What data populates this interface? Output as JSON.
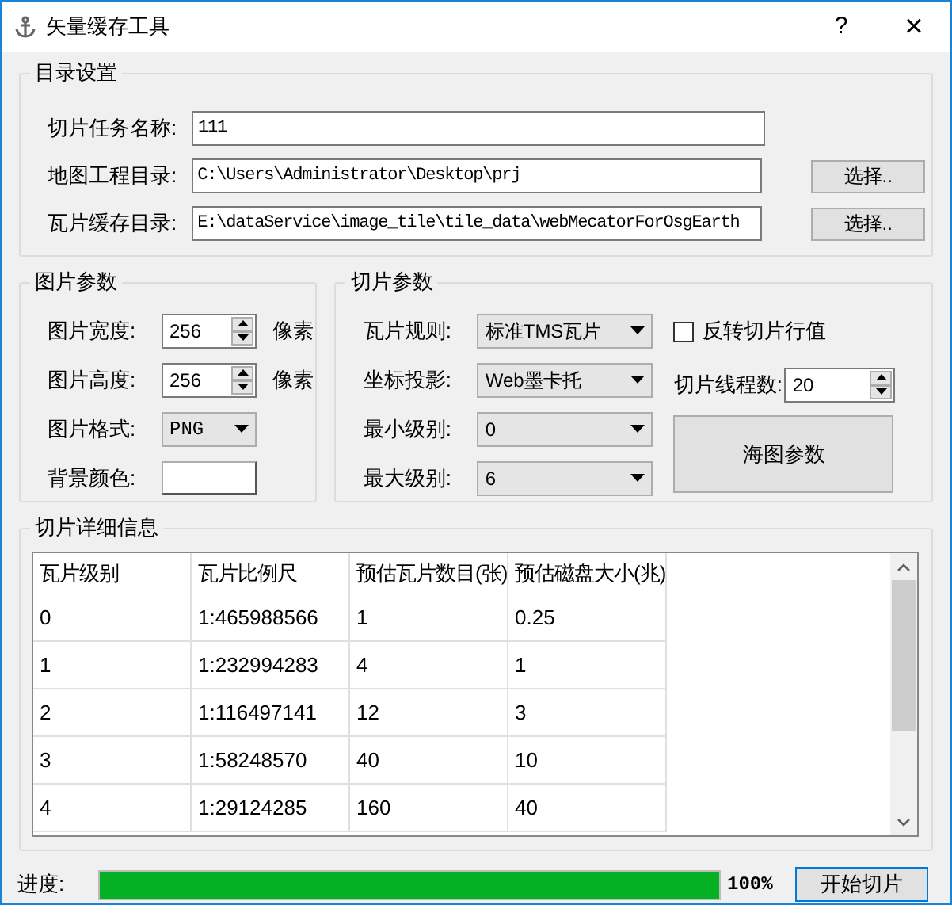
{
  "window": {
    "title": "矢量缓存工具",
    "help": "?",
    "close": "×"
  },
  "directory_settings": {
    "title": "目录设置",
    "fields": [
      {
        "label": "切片任务名称:",
        "value": "111"
      },
      {
        "label": "地图工程目录:",
        "value": "C:\\Users\\Administrator\\Desktop\\prj",
        "button": "选择.."
      },
      {
        "label": "瓦片缓存目录:",
        "value": "E:\\dataService\\image_tile\\tile_data\\webMecatorForOsgEarth",
        "button": "选择.."
      }
    ]
  },
  "image_params": {
    "title": "图片参数",
    "rows": [
      {
        "kind": "spin",
        "label": "图片宽度:",
        "value": "256",
        "unit": "像素"
      },
      {
        "kind": "spin",
        "label": "图片高度:",
        "value": "256",
        "unit": "像素"
      },
      {
        "kind": "combo",
        "label": "图片格式:",
        "value": "PNG"
      },
      {
        "kind": "color",
        "label": "背景颜色:",
        "color": "#ffffff"
      }
    ]
  },
  "tile_params": {
    "title": "切片参数",
    "combos": [
      {
        "label": "瓦片规则:",
        "value": "标准TMS瓦片"
      },
      {
        "label": "坐标投影:",
        "value": "Web墨卡托"
      },
      {
        "label": "最小级别:",
        "value": "0"
      },
      {
        "label": "最大级别:",
        "value": "6"
      }
    ],
    "reverse": {
      "label": "反转切片行值",
      "checked": false
    },
    "threads": {
      "label": "切片线程数:",
      "value": "20"
    },
    "chart_button": "海图参数"
  },
  "details": {
    "title": "切片详细信息",
    "columns": [
      "瓦片级别",
      "瓦片比例尺",
      "预估瓦片数目(张)",
      "预估磁盘大小(兆)"
    ],
    "rows": [
      [
        "0",
        "1:465988566",
        "1",
        "0.25"
      ],
      [
        "1",
        "1:232994283",
        "4",
        "1"
      ],
      [
        "2",
        "1:116497141",
        "12",
        "3"
      ],
      [
        "3",
        "1:58248570",
        "40",
        "10"
      ],
      [
        "4",
        "1:29124285",
        "160",
        "40"
      ]
    ]
  },
  "progress": {
    "label": "进度:",
    "level": 1,
    "reading": "100%",
    "button": "开始切片"
  }
}
